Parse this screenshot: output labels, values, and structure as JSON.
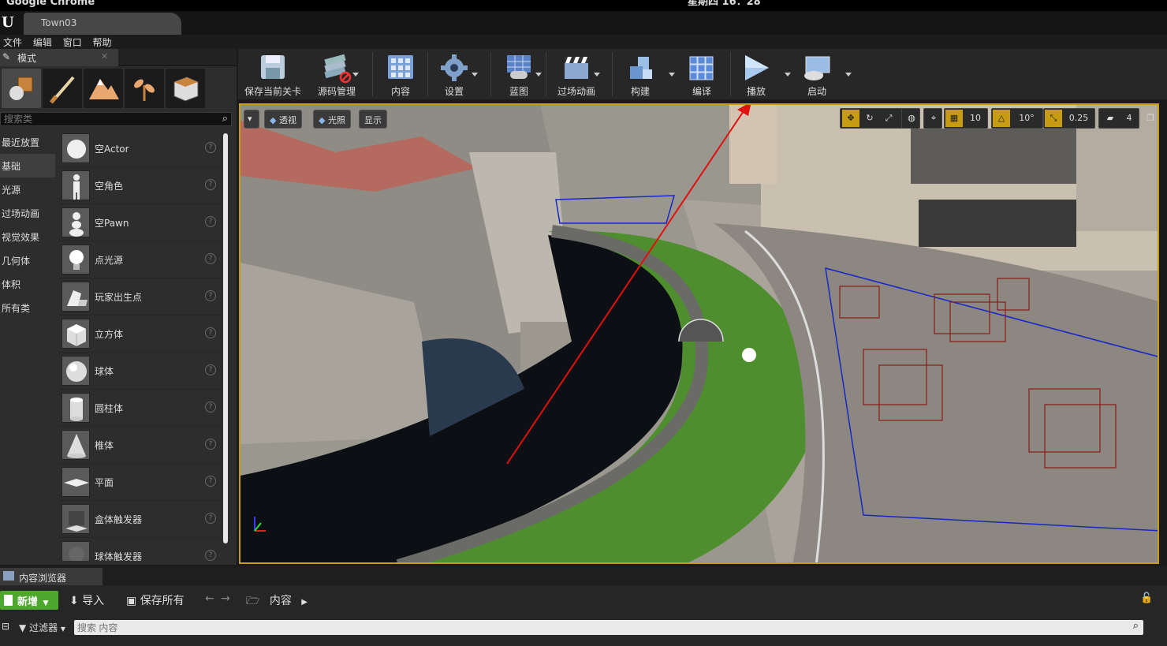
{
  "os": {
    "app_name": "Google Chrome",
    "clock": "星期四 16：28"
  },
  "editor": {
    "level_tab": "Town03"
  },
  "menu": [
    "文件",
    "编辑",
    "窗口",
    "帮助"
  ],
  "modes": {
    "title": "模式",
    "search_placeholder": "搜索类",
    "categories": [
      "最近放置",
      "基础",
      "光源",
      "过场动画",
      "视觉效果",
      "几何体",
      "体积",
      "所有类"
    ],
    "selected_category": "基础",
    "actors": [
      "空Actor",
      "空角色",
      "空Pawn",
      "点光源",
      "玩家出生点",
      "立方体",
      "球体",
      "圆柱体",
      "椎体",
      "平面",
      "盒体触发器",
      "球体触发器"
    ],
    "help_glyph": "?"
  },
  "toolbar": {
    "save": "保存当前关卡",
    "source": "源码管理",
    "content": "内容",
    "settings": "设置",
    "blueprint": "蓝图",
    "cinematics": "过场动画",
    "build": "构建",
    "compile": "编译",
    "play": "播放",
    "launch": "启动"
  },
  "viewport": {
    "perspective": "透视",
    "lighting": "光照",
    "show": "显示",
    "grid_snap": "10",
    "rot_snap": "10°",
    "scale_snap": "0.25",
    "camera_speed": "4"
  },
  "content_browser": {
    "title": "内容浏览器",
    "new": "新增",
    "import": "导入",
    "save_all": "保存所有",
    "path": "内容",
    "filter": "过滤器",
    "search_placeholder": "搜索 内容"
  },
  "colors": {
    "accent_green": "#4ea72d",
    "viewport_border": "#c79c12",
    "annotation_arrow": "#e01010"
  }
}
